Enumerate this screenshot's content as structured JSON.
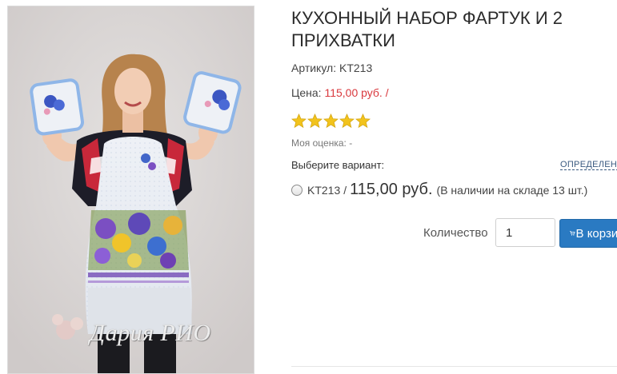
{
  "product": {
    "title": "КУХОННЫЙ НАБОР ФАРТУК И 2 ПРИХВАТКИ",
    "sku_label": "Артикул:",
    "sku_value": "KT213",
    "price_label": "Цена:",
    "price_value": "115,00 руб.",
    "price_slash": "/",
    "rating_stars": 5,
    "my_rating_label": "Моя оценка:",
    "my_rating_value": "-",
    "image_watermark": "Дария РИО"
  },
  "variants": {
    "choose_label": "Выберите вариант:",
    "defined_link": "ОПРЕДЕЛЕННЫЙ",
    "items": [
      {
        "code": "KT213",
        "separator": "/",
        "price": "115,00 руб.",
        "stock": "(В наличии на складе 13 шт.)"
      }
    ]
  },
  "purchase": {
    "quantity_label": "Количество",
    "quantity_value": "1",
    "cart_button_label": "В корзину"
  },
  "colors": {
    "price_red": "#d9383d",
    "button_blue": "#2a7ac2",
    "star_gold": "#f2c31c"
  },
  "icons": {
    "star": "star-icon",
    "cart": "cart-icon",
    "radio": "radio-icon"
  }
}
